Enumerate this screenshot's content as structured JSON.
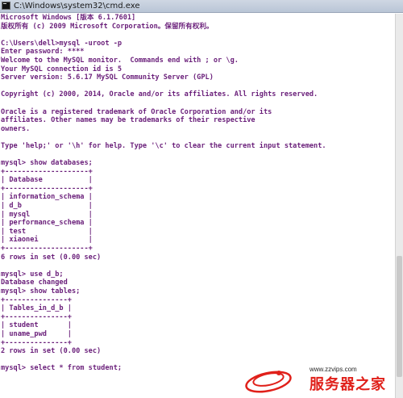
{
  "window": {
    "title": "C:\\Windows\\system32\\cmd.exe"
  },
  "console": {
    "lines": [
      "Microsoft Windows [版本 6.1.7601]",
      "版权所有 (c) 2009 Microsoft Corporation。保留所有权利。",
      "",
      "C:\\Users\\dell>mysql -uroot -p",
      "Enter password: ****",
      "Welcome to the MySQL monitor.  Commands end with ; or \\g.",
      "Your MySQL connection id is 5",
      "Server version: 5.6.17 MySQL Community Server (GPL)",
      "",
      "Copyright (c) 2000, 2014, Oracle and/or its affiliates. All rights reserved.",
      "",
      "Oracle is a registered trademark of Oracle Corporation and/or its",
      "affiliates. Other names may be trademarks of their respective",
      "owners.",
      "",
      "Type 'help;' or '\\h' for help. Type '\\c' to clear the current input statement.",
      "",
      "mysql> show databases;",
      "+--------------------+",
      "| Database           |",
      "+--------------------+",
      "| information_schema |",
      "| d_b                |",
      "| mysql              |",
      "| performance_schema |",
      "| test               |",
      "| xiaonei            |",
      "+--------------------+",
      "6 rows in set (0.00 sec)",
      "",
      "mysql> use d_b;",
      "Database changed",
      "mysql> show tables;",
      "+---------------+",
      "| Tables_in_d_b |",
      "+---------------+",
      "| student       |",
      "| uname_pwd     |",
      "+---------------+",
      "2 rows in set (0.00 sec)",
      "",
      "mysql> select * from student;"
    ]
  },
  "watermark": {
    "url": "www.zzvips.com",
    "brand": "服务器之家"
  },
  "colors": {
    "console_text": "#6a1f7a",
    "console_bg": "#ffffff",
    "brand_red": "#e0201a"
  }
}
